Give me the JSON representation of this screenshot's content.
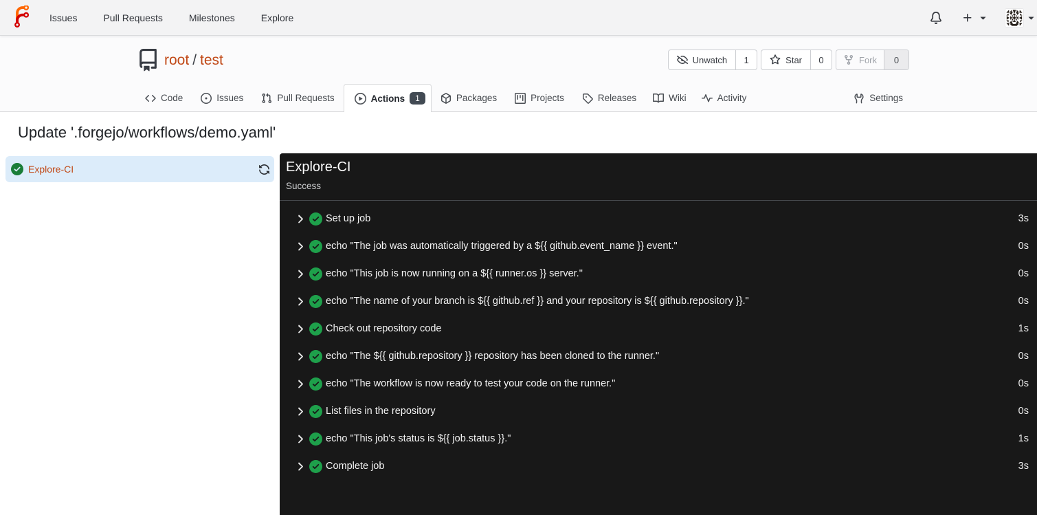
{
  "navbar": {
    "logo": "forgejo-logo",
    "items": [
      {
        "label": "Issues"
      },
      {
        "label": "Pull Requests"
      },
      {
        "label": "Milestones"
      },
      {
        "label": "Explore"
      }
    ],
    "right_icons": [
      "bell-icon",
      "plus-icon",
      "avatar"
    ]
  },
  "repo": {
    "owner": "root",
    "separator": "/",
    "name": "test",
    "actions": [
      {
        "label": "Unwatch",
        "count": "1",
        "icon": "eye-closed-icon"
      },
      {
        "label": "Star",
        "count": "0",
        "icon": "star-icon"
      },
      {
        "label": "Fork",
        "count": "0",
        "icon": "fork-icon",
        "disabled": true
      }
    ],
    "tabs": [
      {
        "label": "Code",
        "icon": "code-icon"
      },
      {
        "label": "Issues",
        "icon": "issue-icon"
      },
      {
        "label": "Pull Requests",
        "icon": "pull-request-icon"
      },
      {
        "label": "Actions",
        "icon": "play-circle-icon",
        "badge": "1",
        "active": true
      },
      {
        "label": "Packages",
        "icon": "package-icon"
      },
      {
        "label": "Projects",
        "icon": "project-icon"
      },
      {
        "label": "Releases",
        "icon": "tag-icon"
      },
      {
        "label": "Wiki",
        "icon": "book-icon"
      },
      {
        "label": "Activity",
        "icon": "pulse-icon"
      },
      {
        "label": "Settings",
        "icon": "wrench-icon",
        "align": "right"
      }
    ]
  },
  "run": {
    "title": "Update '.forgejo/workflows/demo.yaml'",
    "jobs": [
      {
        "name": "Explore-CI",
        "status": "success",
        "selected": true
      }
    ],
    "panel": {
      "job_name": "Explore-CI",
      "status_text": "Success",
      "steps": [
        {
          "name": "Set up job",
          "duration": "3s"
        },
        {
          "name": "echo \"The job was automatically triggered by a ${{ github.event_name }} event.\"",
          "duration": "0s"
        },
        {
          "name": "echo \"This job is now running on a ${{ runner.os }} server.\"",
          "duration": "0s"
        },
        {
          "name": "echo \"The name of your branch is ${{ github.ref }} and your repository is ${{ github.repository }}.\"",
          "duration": "0s"
        },
        {
          "name": "Check out repository code",
          "duration": "1s"
        },
        {
          "name": "echo \"The ${{ github.repository }} repository has been cloned to the runner.\"",
          "duration": "0s"
        },
        {
          "name": "echo \"The workflow is now ready to test your code on the runner.\"",
          "duration": "0s"
        },
        {
          "name": "List files in the repository",
          "duration": "0s"
        },
        {
          "name": "echo \"This job's status is ${{ job.status }}.\"",
          "duration": "1s"
        },
        {
          "name": "Complete job",
          "duration": "3s"
        }
      ]
    }
  },
  "colors": {
    "accent_link": "#c14a18",
    "success_green_light": "#1a7d38",
    "success_green_dark": "#1ea04b",
    "console_bg": "#181818",
    "selected_job_bg": "#dcecfa",
    "badge_bg": "#424a53"
  }
}
